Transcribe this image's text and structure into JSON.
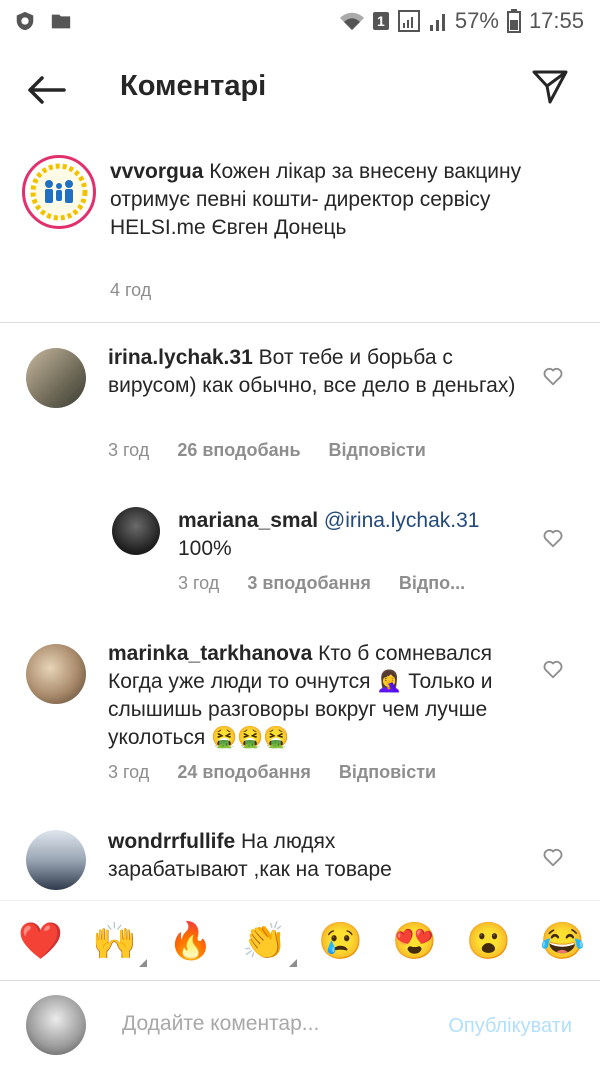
{
  "status_bar": {
    "sim_badge": "1",
    "battery": "57%",
    "time": "17:55"
  },
  "header": {
    "title": "Коментарі",
    "back_icon": "arrow-left-icon",
    "share_icon": "paper-plane-icon"
  },
  "caption": {
    "username": "vvvorgua",
    "text": " Кожен лікар за внесену вакцину отримує певні кошти- директор сервісу HELSI.me Євген Донець",
    "time": "4 год"
  },
  "comments": [
    {
      "username": "irina.lychak.31",
      "text": " Вот тебе и борьба с вирусом) как обычно,  все дело в деньгах)",
      "time": "3 год",
      "likes": "26 вподобань",
      "reply": "Відповісти"
    },
    {
      "username": "mariana_smal",
      "mention": " @irina.lychak.31",
      "text": "100%",
      "time": "3 год",
      "likes": "3 вподобання",
      "reply": "Відпо..."
    },
    {
      "username": "marinka_tarkhanova",
      "text": " Кто б сомневался Когда уже люди то очнутся 🤦‍♀️ Только и слышишь разговоры вокруг чем лучше уколоться 🤮🤮🤮",
      "time": "3 год",
      "likes": "24 вподобання",
      "reply": "Відповісти"
    },
    {
      "username": "wondrrfullife",
      "text": " На людях зарабатывают ,как на товаре"
    }
  ],
  "reactions": [
    "❤️",
    "🙌",
    "🔥",
    "👏",
    "😢",
    "😍",
    "😮",
    "😂"
  ],
  "composer": {
    "placeholder": "Додайте коментар...",
    "publish": "Опублікувати"
  }
}
